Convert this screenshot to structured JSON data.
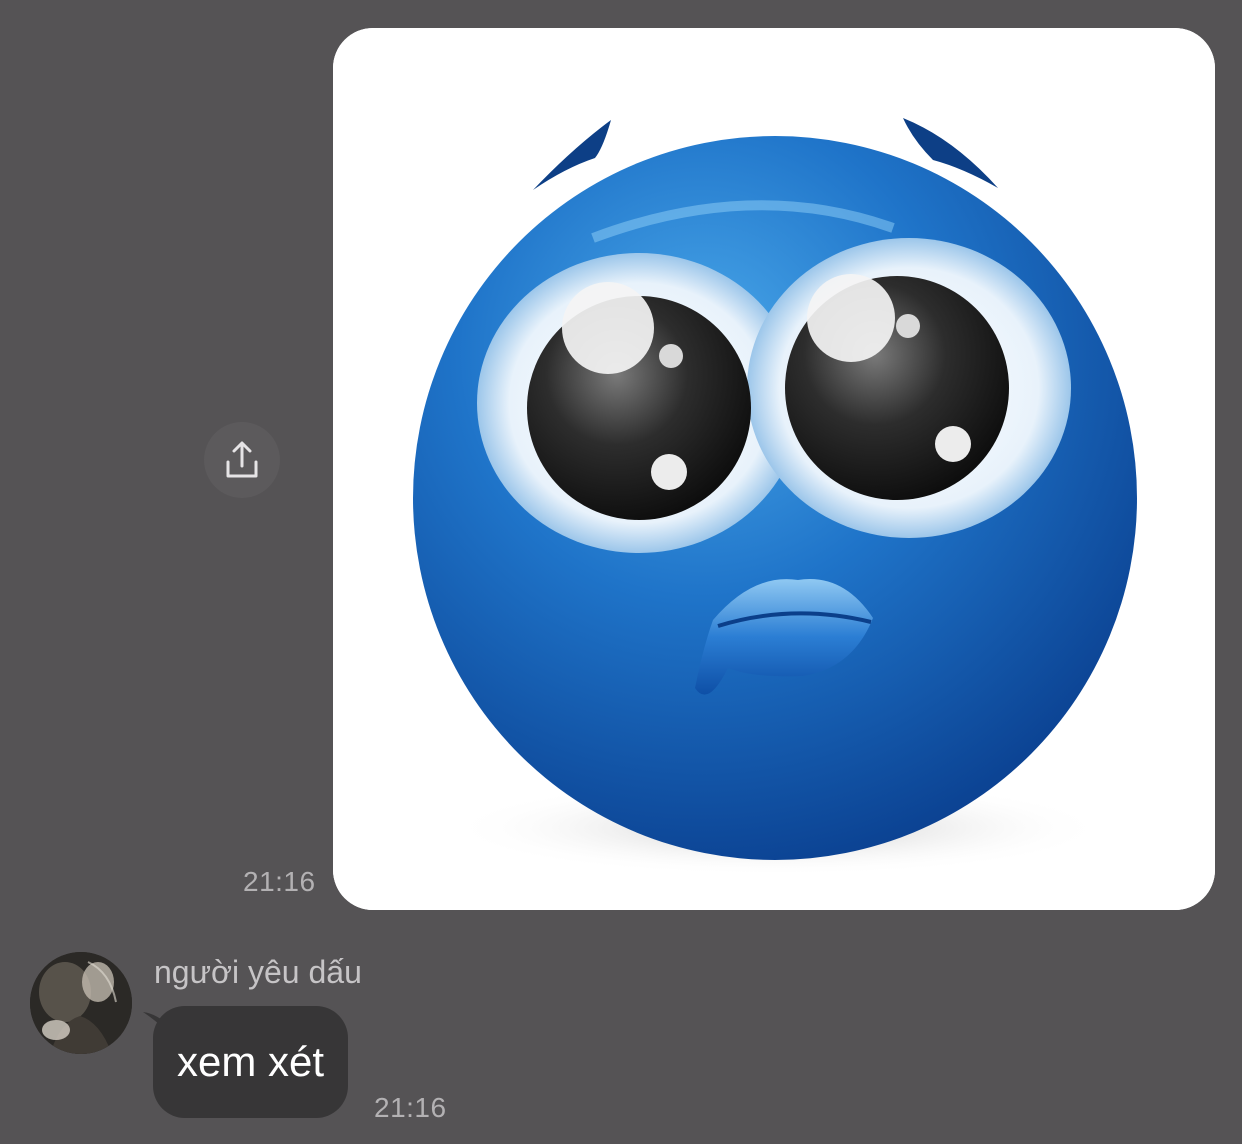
{
  "outgoing_message": {
    "image_icon": "crying-blue-emoji-image",
    "share_icon": "share-upload-icon",
    "time": "21:16"
  },
  "incoming_message": {
    "avatar_icon": "contact-avatar-photo",
    "sender_name": "người yêu dấu",
    "text": "xem xét",
    "time": "21:16"
  },
  "colors": {
    "background": "#555355",
    "incoming_bubble": "#373637",
    "timestamp": "#b3b1b3",
    "emoji_blue": "#1f74c9"
  }
}
